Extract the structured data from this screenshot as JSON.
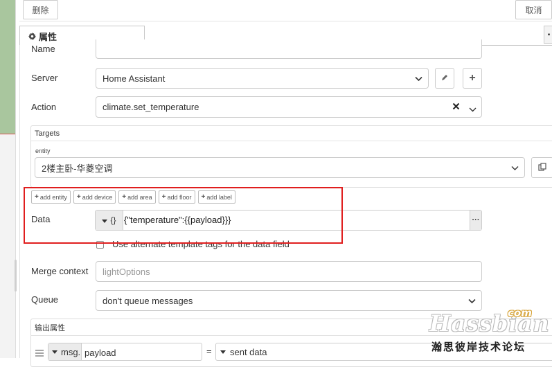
{
  "top_buttons": {
    "delete": "删除",
    "cancel": "取消"
  },
  "tab": {
    "label": "属性"
  },
  "fields": {
    "name": {
      "label": "Name",
      "value": ""
    },
    "server": {
      "label": "Server",
      "value": "Home Assistant"
    },
    "action": {
      "label": "Action",
      "value": "climate.set_temperature"
    }
  },
  "targets": {
    "title": "Targets",
    "entity_label": "entity",
    "entity_value": "2楼主卧-华菱空调",
    "buttons": [
      "add entity",
      "add device",
      "add area",
      "add floor",
      "add label"
    ]
  },
  "data": {
    "label": "Data",
    "type_icon": "{}",
    "value": "{\"temperature\":{{payload}}}",
    "checkbox_label": "Use alternate template tags for the data field",
    "checkbox_checked": false
  },
  "merge_context": {
    "label": "Merge context",
    "placeholder": "lightOptions"
  },
  "queue": {
    "label": "Queue",
    "value": "don't queue messages"
  },
  "output": {
    "title": "输出属性",
    "msg_prefix": "msg.",
    "msg_value": "payload",
    "equals": "=",
    "source_value": "sent data"
  },
  "watermark": {
    "brand": "Hassbian",
    "com": "com",
    "tagline": "瀚思彼岸技术论坛"
  },
  "colors": {
    "highlight": "#e01e1e",
    "canvas_green": "#a9c69e"
  }
}
